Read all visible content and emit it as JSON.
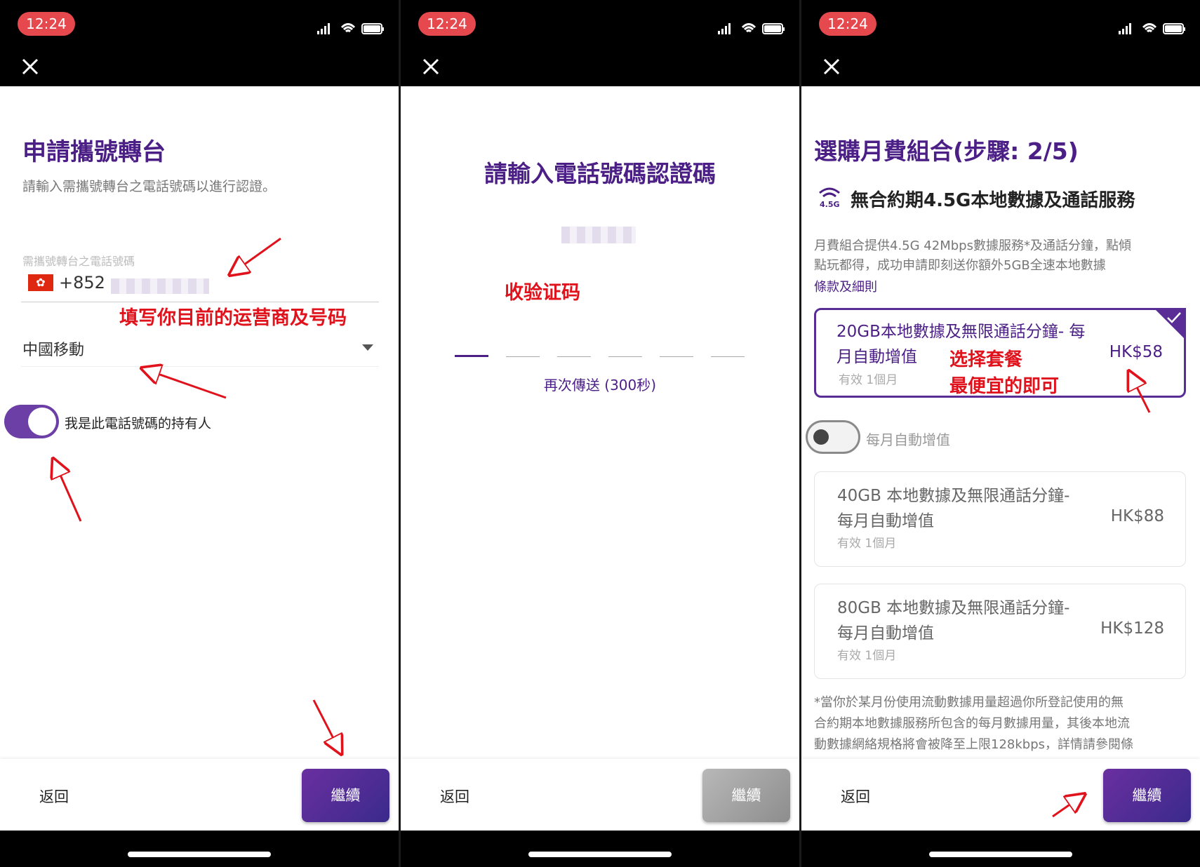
{
  "status": {
    "time": "12:24"
  },
  "screen1": {
    "title": "申請攜號轉台",
    "subtitle": "請輸入需攜號轉台之電話號碼以進行認證。",
    "phone_label": "需攜號轉台之電話號碼",
    "country_code": "+852",
    "carrier": "中國移動",
    "owner_toggle_label": "我是此電話號碼的持有人",
    "owner_toggle_on": true,
    "annotation": "填写你目前的运营商及号码"
  },
  "screen2": {
    "title": "請輸入電話號碼認證碼",
    "resend": "再次傳送 (300秒)",
    "code_digits": 6,
    "annotation": "收验证码"
  },
  "screen3": {
    "title": "選購月費組合(步驟: 2/5)",
    "service": "無合約期4.5G本地數據及通話服務",
    "service_icon_label": "4.5G",
    "desc_line1": "月費組合提供4.5G 42Mbps數據服務*及通話分鐘，點傾",
    "desc_line2": "點玩都得，成功申請即刻送你額外5GB全速本地數據",
    "terms_link": "條款及細則",
    "plans": [
      {
        "line1": "20GB本地數據及無限通話分鐘- 每",
        "line2": "月自動增值",
        "price": "HK$58",
        "validity": "有效 1個月",
        "selected": true
      },
      {
        "line1": "40GB 本地數據及無限通話分鐘-",
        "line2": "每月自動增值",
        "price": "HK$88",
        "validity": "有效 1個月",
        "selected": false
      },
      {
        "line1": "80GB 本地數據及無限通話分鐘-",
        "line2": "每月自動增值",
        "price": "HK$128",
        "validity": "有效 1個月",
        "selected": false
      }
    ],
    "auto_topup_label": "每月自動增值",
    "auto_topup_on": false,
    "footnote_line1": "*當你於某月份使用流動數據用量超過你所登記使用的無",
    "footnote_line2": "合約期本地數據服務所包含的每月數據用量，其後本地流",
    "footnote_line3": "動數據網絡規格將會被降至上限128kbps，詳情請參閱條",
    "annotation_line1": "选择套餐",
    "annotation_line2": "最便宜的即可"
  },
  "footer": {
    "back": "返回",
    "continue": "繼續"
  },
  "colors": {
    "brand": "#4b1f86",
    "annotation": "#e0121c",
    "status_pill": "#e5484d"
  }
}
